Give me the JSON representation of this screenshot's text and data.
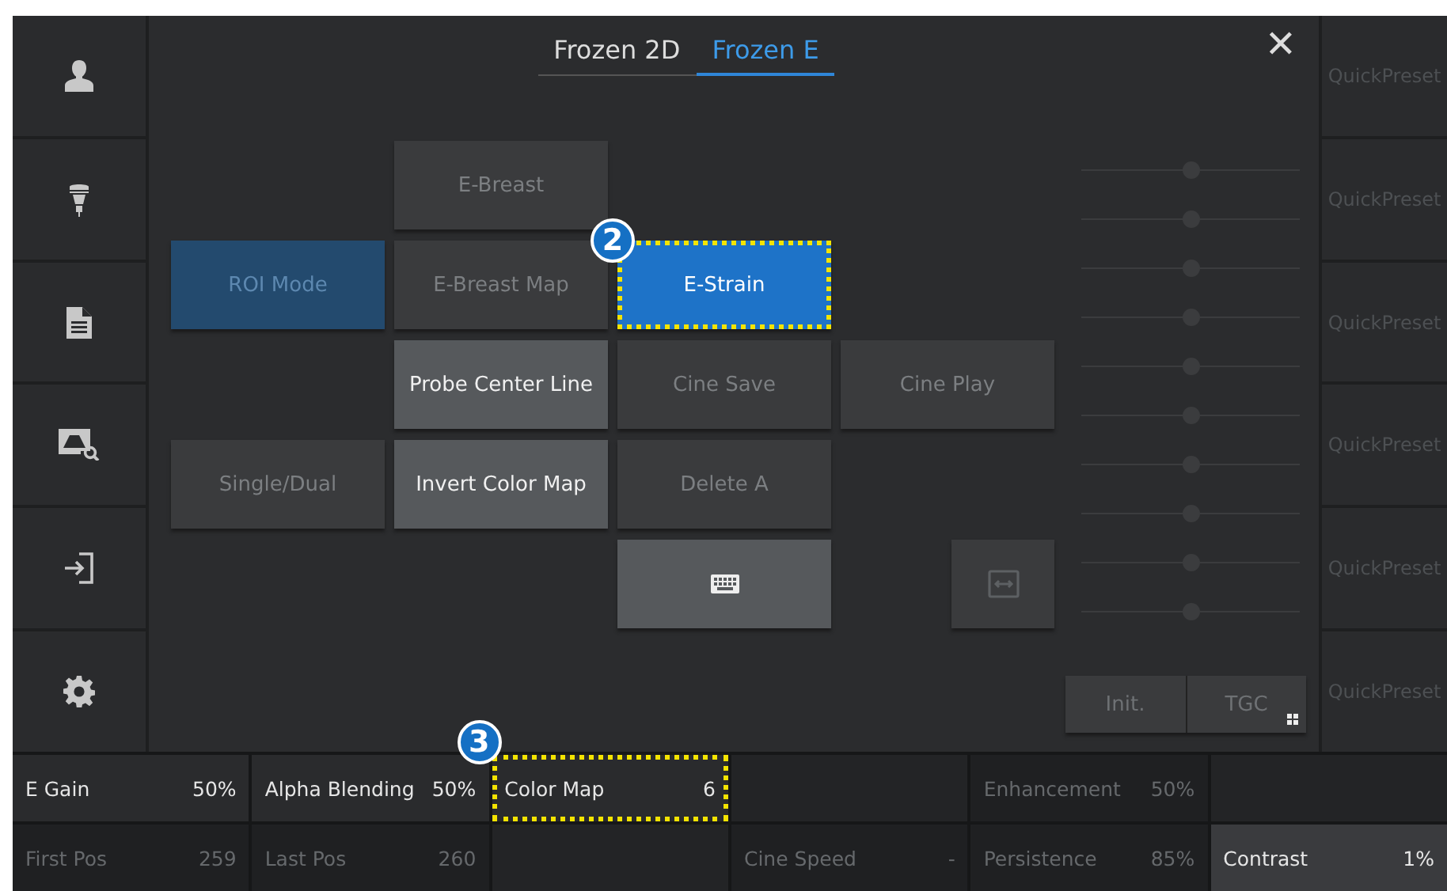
{
  "sidebar": {
    "items": [
      {
        "kind": "person"
      },
      {
        "kind": "probe"
      },
      {
        "kind": "report"
      },
      {
        "kind": "image-zoom"
      },
      {
        "kind": "exit"
      },
      {
        "kind": "settings"
      }
    ]
  },
  "tabs": [
    {
      "label": "Frozen 2D",
      "selected": false
    },
    {
      "label": "Frozen E",
      "selected": true
    }
  ],
  "close": {
    "label": "✕"
  },
  "button_grid": {
    "rows": [
      [
        {
          "kind": "blank"
        },
        {
          "kind": "text",
          "label": "E-Breast",
          "disabled": true,
          "selected": false
        },
        {
          "kind": "blank"
        },
        {
          "kind": "blank"
        }
      ],
      [
        {
          "kind": "text",
          "label": "ROI Mode",
          "disabled": true,
          "selected": true
        },
        {
          "kind": "text",
          "label": "E-Breast Map",
          "disabled": true,
          "selected": false
        },
        {
          "kind": "text",
          "label": "E-Strain",
          "disabled": false,
          "selected": true,
          "highlighted": true,
          "badge": "2"
        },
        {
          "kind": "blank"
        }
      ],
      [
        {
          "kind": "blank"
        },
        {
          "kind": "text",
          "label": "Probe Center Line",
          "disabled": false,
          "selected": false
        },
        {
          "kind": "text",
          "label": "Cine Save",
          "disabled": true,
          "selected": false
        },
        {
          "kind": "text",
          "label": "Cine Play",
          "disabled": true,
          "selected": false
        }
      ],
      [
        {
          "kind": "text",
          "label": "Single/Dual",
          "disabled": true,
          "selected": false
        },
        {
          "kind": "text",
          "label": "Invert Color Map",
          "disabled": false,
          "selected": false
        },
        {
          "kind": "text",
          "label": "Delete A",
          "disabled": true,
          "selected": false
        },
        {
          "kind": "blank"
        }
      ],
      [
        {
          "kind": "blank"
        },
        {
          "kind": "blank"
        },
        {
          "kind": "keyboard",
          "disabled": false
        },
        {
          "kind": "resize",
          "disabled": true
        }
      ]
    ]
  },
  "tgc": {
    "sliders": [
      {
        "level": 0.5
      },
      {
        "level": 0.5
      },
      {
        "level": 0.5
      },
      {
        "level": 0.5
      },
      {
        "level": 0.5
      },
      {
        "level": 0.5
      },
      {
        "level": 0.5
      },
      {
        "level": 0.5
      },
      {
        "level": 0.5
      },
      {
        "level": 0.5
      }
    ],
    "buttons": [
      {
        "label": "Init.",
        "kind": "plain"
      },
      {
        "label": "TGC",
        "kind": "menu"
      }
    ]
  },
  "quick_presets": [
    {
      "label": "QuickPreset"
    },
    {
      "label": "QuickPreset"
    },
    {
      "label": "QuickPreset"
    },
    {
      "label": "QuickPreset"
    },
    {
      "label": "QuickPreset"
    },
    {
      "label": "QuickPreset"
    }
  ],
  "parameters": {
    "rows": [
      [
        {
          "kind": "param",
          "label": "E Gain",
          "value": "50%",
          "disabled": false
        },
        {
          "kind": "param",
          "label": "Alpha Blending",
          "value": "50%",
          "disabled": false
        },
        {
          "kind": "param",
          "label": "Color Map",
          "value": "6",
          "disabled": false,
          "highlighted": true,
          "badge": "3"
        },
        {
          "kind": "blank"
        },
        {
          "kind": "param",
          "label": "Enhancement",
          "value": "50%",
          "disabled": true
        },
        {
          "kind": "blank"
        }
      ],
      [
        {
          "kind": "param",
          "label": "First Pos",
          "value": "259",
          "disabled": true
        },
        {
          "kind": "param",
          "label": "Last Pos",
          "value": "260",
          "disabled": true
        },
        {
          "kind": "blank"
        },
        {
          "kind": "param",
          "label": "Cine Speed",
          "value": "-",
          "disabled": true
        },
        {
          "kind": "param",
          "label": "Persistence",
          "value": "85%",
          "disabled": true
        },
        {
          "kind": "param",
          "label": "Contrast",
          "value": "1%",
          "disabled": false,
          "raised": true
        }
      ]
    ]
  }
}
